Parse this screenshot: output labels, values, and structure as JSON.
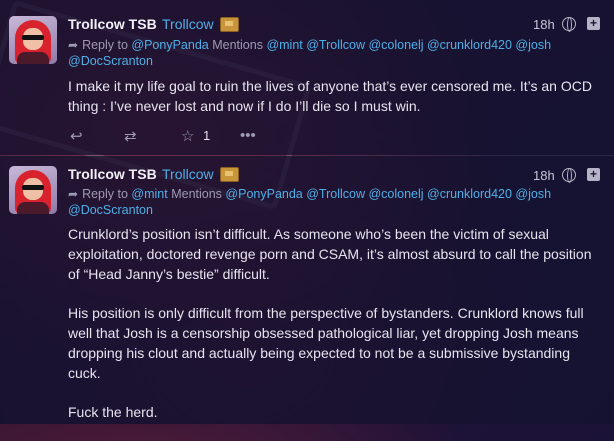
{
  "posts": [
    {
      "author_name": "Trollcow TSB",
      "author_handle": "Trollcow",
      "time": "18h",
      "reply_to_label": "Reply to",
      "reply_to": "@PonyPanda",
      "mentions_label": "Mentions",
      "mentions": "@mint @Trollcow @colonelj @crunklord420 @josh",
      "mentions_overflow": "@DocScranton",
      "content": [
        "I make it my life goal to ruin the lives of anyone that’s ever censored me. It’s an OCD thing : I’ve never lost and now if I do I’ll die so I must win."
      ],
      "favorite_count": "1"
    },
    {
      "author_name": "Trollcow TSB",
      "author_handle": "Trollcow",
      "time": "18h",
      "reply_to_label": "Reply to",
      "reply_to": "@mint",
      "mentions_label": "Mentions",
      "mentions": "@PonyPanda @Trollcow @colonelj @crunklord420 @josh",
      "mentions_overflow": "@DocScranton",
      "content": [
        "Crunklord’s position isn’t difficult. As someone who’s been the victim of sexual exploitation, doctored revenge porn and CSAM, it’s almost absurd to call the position of “Head Janny’s bestie” difficult.",
        "His position is only difficult from the perspective of bystanders. Crunklord knows full well that Josh is a censorship obsessed pathological liar, yet dropping Josh means dropping his clout and actually being expected to not be a submissive bystanding cuck.",
        "Fuck the herd."
      ]
    }
  ],
  "icons": {
    "reply": "reply-icon",
    "retweet": "retweet-icon",
    "favorite": "star-icon",
    "more": "ellipsis-icon",
    "visibility": "globe-icon",
    "expand": "plus-icon"
  }
}
